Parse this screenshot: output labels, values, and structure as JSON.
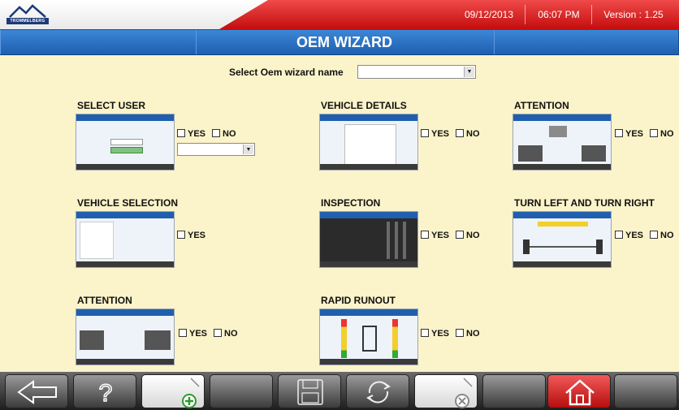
{
  "header": {
    "logo_text": "TROMMELBERG",
    "date": "09/12/2013",
    "time": "06:07 PM",
    "version": "Version : 1.25"
  },
  "titlebar": {
    "title": "OEM WIZARD"
  },
  "selector": {
    "label": "Select Oem wizard name",
    "value": ""
  },
  "options": {
    "yes": "YES",
    "no": "NO"
  },
  "sections": {
    "select_user": {
      "title": "SELECT USER",
      "dropdown_value": ""
    },
    "vehicle_details": {
      "title": "VEHICLE DETAILS"
    },
    "attention_1": {
      "title": "ATTENTION"
    },
    "vehicle_selection": {
      "title": "VEHICLE SELECTION"
    },
    "inspection": {
      "title": "INSPECTION"
    },
    "turn": {
      "title": "TURN LEFT AND TURN RIGHT"
    },
    "attention_2": {
      "title": "ATTENTION"
    },
    "rapid_runout": {
      "title": "RAPID RUNOUT"
    }
  },
  "toolbar": {
    "buttons": [
      "back-icon",
      "help-icon",
      "add-document-icon",
      "blank",
      "save-icon",
      "refresh-icon",
      "delete-document-icon",
      "blank",
      "home-icon",
      "blank"
    ]
  },
  "colors": {
    "accent_blue": "#2a70c3",
    "header_red": "#d81f1f",
    "background": "#fbf3c9"
  }
}
